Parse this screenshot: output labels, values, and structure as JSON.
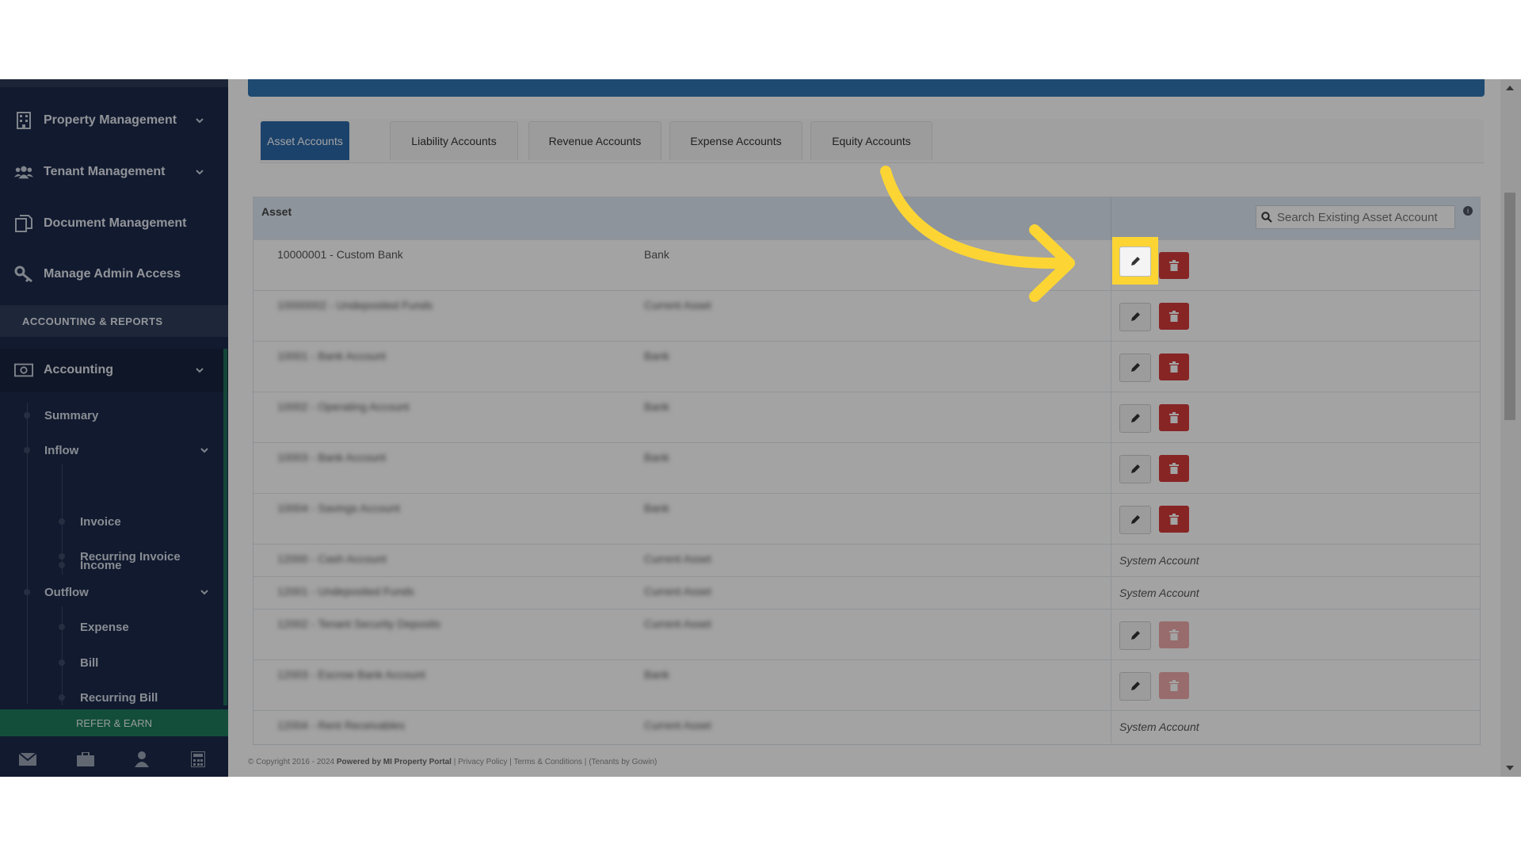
{
  "sidebar": {
    "items": [
      {
        "label": "Property Management",
        "icon": "building-icon"
      },
      {
        "label": "Tenant Management",
        "icon": "users-icon"
      },
      {
        "label": "Document Management",
        "icon": "documents-icon"
      },
      {
        "label": "Manage Admin Access",
        "icon": "key-icon"
      }
    ],
    "section_header": "ACCOUNTING & REPORTS",
    "accounting": {
      "label": "Accounting",
      "icon": "money-icon"
    },
    "sub_items": {
      "summary": "Summary",
      "inflow": "Inflow",
      "income": "Income",
      "invoice": "Invoice",
      "recurring_invoice": "Recurring Invoice",
      "outflow": "Outflow",
      "expense": "Expense",
      "bill": "Bill",
      "recurring_bill": "Recurring Bill"
    },
    "refer": "REFER & EARN",
    "bottom_icons": [
      "envelope-icon",
      "briefcase-icon",
      "user-icon",
      "calculator-icon"
    ]
  },
  "tabs": {
    "asset": "Asset Accounts",
    "liability": "Liability Accounts",
    "revenue": "Revenue Accounts",
    "expense": "Expense Accounts",
    "equity": "Equity Accounts",
    "active": "Asset Accounts"
  },
  "table": {
    "header": "Asset",
    "search_placeholder": "Search Existing Asset Account",
    "rows": [
      {
        "name": "10000001 - Custom Bank",
        "type": "Bank",
        "actions": "edit-delete",
        "blurred": false
      },
      {
        "name": "10000002 - Undeposited Funds",
        "type": "Current Asset",
        "actions": "edit-delete",
        "blurred": true
      },
      {
        "name": "10001 - Bank Account",
        "type": "Bank",
        "actions": "edit-delete",
        "blurred": true
      },
      {
        "name": "10002 - Operating Account",
        "type": "Bank",
        "actions": "edit-delete",
        "blurred": true
      },
      {
        "name": "10003 - Bank Account",
        "type": "Bank",
        "actions": "edit-delete",
        "blurred": true
      },
      {
        "name": "10004 - Savings Account",
        "type": "Bank",
        "actions": "edit-delete",
        "blurred": true
      },
      {
        "name": "12000 - Cash Account",
        "type": "Current Asset",
        "actions": "system",
        "blurred": true
      },
      {
        "name": "12001 - Undeposited Funds",
        "type": "Current Asset",
        "actions": "system",
        "blurred": true
      },
      {
        "name": "12002 - Tenant Security Deposits",
        "type": "Current Asset",
        "actions": "edit-delete-disabled",
        "blurred": true
      },
      {
        "name": "12003 - Escrow Bank Account",
        "type": "Bank",
        "actions": "edit-delete-disabled",
        "blurred": true
      },
      {
        "name": "12004 - Rent Receivables",
        "type": "Current Asset",
        "actions": "system",
        "blurred": true
      }
    ],
    "system_account_label": "System Account"
  },
  "footer": {
    "copyright": "© Copyright 2016 - 2024",
    "powered": "Powered by MI Property Portal",
    "privacy": "Privacy Policy",
    "terms": "Terms & Conditions",
    "tail": "(Tenants by Gowin)"
  },
  "colors": {
    "sidebar_bg": "#1b2a4a",
    "accent_blue": "#2b68a8",
    "delete_red": "#d33a3a",
    "highlight_yellow": "#fcd534",
    "refer_green": "#1e7a5b"
  }
}
